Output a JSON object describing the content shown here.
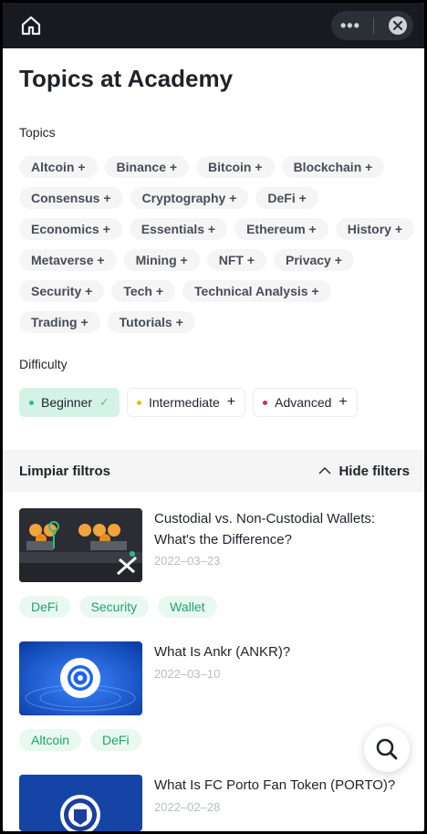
{
  "page": {
    "title": "Topics at Academy",
    "topics_label": "Topics",
    "difficulty_label": "Difficulty"
  },
  "topics": [
    [
      "Altcoin +",
      "Binance +",
      "Bitcoin +",
      "Blockchain +"
    ],
    [
      "Consensus +",
      "Cryptography +",
      "DeFi +"
    ],
    [
      "Economics +",
      "Essentials +",
      "Ethereum +",
      "History +"
    ],
    [
      "Metaverse +",
      "Mining +",
      "NFT +",
      "Privacy +"
    ],
    [
      "Security +",
      "Tech +",
      "Technical Analysis +"
    ],
    [
      "Trading +",
      "Tutorials +"
    ]
  ],
  "difficulty": [
    {
      "label": "Beginner",
      "suffix": "✓",
      "selected": true,
      "dot_color": "#2ebd85"
    },
    {
      "label": "Intermediate",
      "suffix": "+",
      "selected": false,
      "dot_color": "#f0b90b"
    },
    {
      "label": "Advanced",
      "suffix": "+",
      "selected": false,
      "dot_color": "#cf304a"
    }
  ],
  "filters": {
    "clear_label": "Limpiar filtros",
    "hide_label": "Hide filters"
  },
  "articles": [
    {
      "title": "Custodial vs. Non-Custodial Wallets: What's the Difference?",
      "date": "2022–03–23",
      "tags": [
        "DeFi",
        "Security",
        "Wallet"
      ]
    },
    {
      "title": "What Is Ankr (ANKR)?",
      "date": "2022–03–10",
      "tags": [
        "Altcoin",
        "DeFi"
      ]
    },
    {
      "title": "What Is FC Porto Fan Token (PORTO)?",
      "date": "2022–02–28",
      "tags": []
    }
  ],
  "icons": {
    "home": "home-icon",
    "more": "more-dots-icon",
    "close": "close-icon",
    "search": "search-icon",
    "chevron": "chevron-up-icon"
  },
  "colors": {
    "topbar": "#181a20",
    "accent_green": "#1fa36c",
    "tag_bg": "#eaf8f2",
    "chip_bg": "#f5f5f5"
  }
}
